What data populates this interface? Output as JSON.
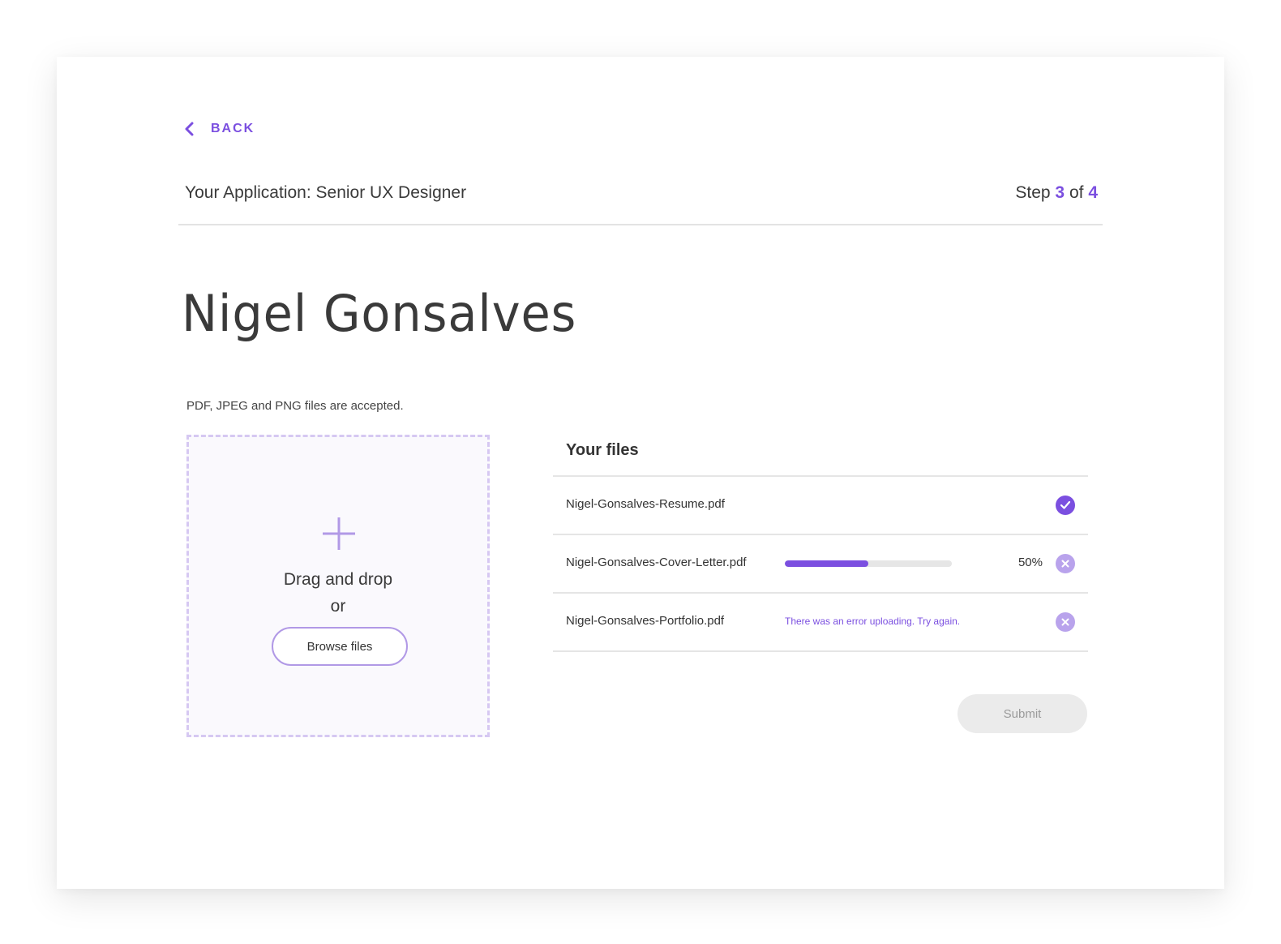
{
  "nav": {
    "back_label": "BACK"
  },
  "header": {
    "app_title": "Your Application: Senior UX Designer",
    "step_prefix": "Step",
    "step_current": "3",
    "step_of": "of",
    "step_total": "4"
  },
  "applicant": {
    "name": "Nigel Gonsalves"
  },
  "upload": {
    "accepted_note": "PDF, JPEG and PNG files are accepted.",
    "drag_text": "Drag and drop",
    "or_text": "or",
    "browse_label": "Browse files"
  },
  "files": {
    "title": "Your files",
    "items": [
      {
        "name": "Nigel-Gonsalves-Resume.pdf",
        "status": "complete"
      },
      {
        "name": "Nigel-Gonsalves-Cover-Letter.pdf",
        "status": "uploading",
        "progress": 50,
        "progress_label": "50%"
      },
      {
        "name": "Nigel-Gonsalves-Portfolio.pdf",
        "status": "error",
        "error_text": "There was an error uploading. Try again."
      }
    ]
  },
  "actions": {
    "submit_label": "Submit",
    "submit_disabled": true
  },
  "colors": {
    "accent": "#7b4fe0",
    "accent_light": "#b9a3ec",
    "dropzone_border": "#d6c8f2",
    "divider": "#e5e5e5",
    "disabled_bg": "#ebebeb",
    "disabled_text": "#9a9a9a"
  },
  "icons": {
    "back": "chevron-left-icon",
    "add": "plus-icon",
    "complete": "check-circle-icon",
    "cancel": "close-circle-icon"
  }
}
